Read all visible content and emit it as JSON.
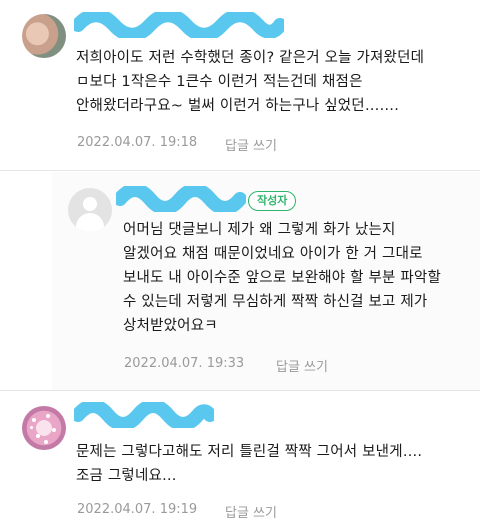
{
  "comments": [
    {
      "text_lines": [
        "저희아이도 저런 수학했던 종이? 같은거 오늘 가져왔던데",
        "ㅁ보다 1작은수 1큰수 이런거 적는건데 채점은",
        "안해왔더라구요~ 벌써 이런거 하는구나 싶었던……."
      ],
      "timestamp": "2022.04.07. 19:18",
      "reply_label": "답글 쓰기"
    },
    {
      "badge": "작성자",
      "text_lines": [
        "어머님 댓글보니 제가 왜 그렇게 화가 났는지",
        "알겠어요 채점 때문이었네요 아이가 한 거 그대로",
        "보내도 내 아이수준 앞으로 보완해야 할 부분 파악할",
        "수 있는데 저렇게 무심하게 짝짝 하신걸 보고 제가",
        "상처받았어요ㅋ"
      ],
      "timestamp": "2022.04.07. 19:33",
      "reply_label": "답글 쓰기"
    },
    {
      "text_lines": [
        "문제는 그렇다고해도 저리 틀린걸 짝짝 그어서 보낸게….",
        "조금 그렇네요…"
      ],
      "timestamp": "2022.04.07. 19:19",
      "reply_label": "답글 쓰기"
    }
  ],
  "colors": {
    "censor_blob": "#5ac8ee",
    "author_badge": "#2fb46b",
    "meta_text": "#9a9a9a"
  }
}
